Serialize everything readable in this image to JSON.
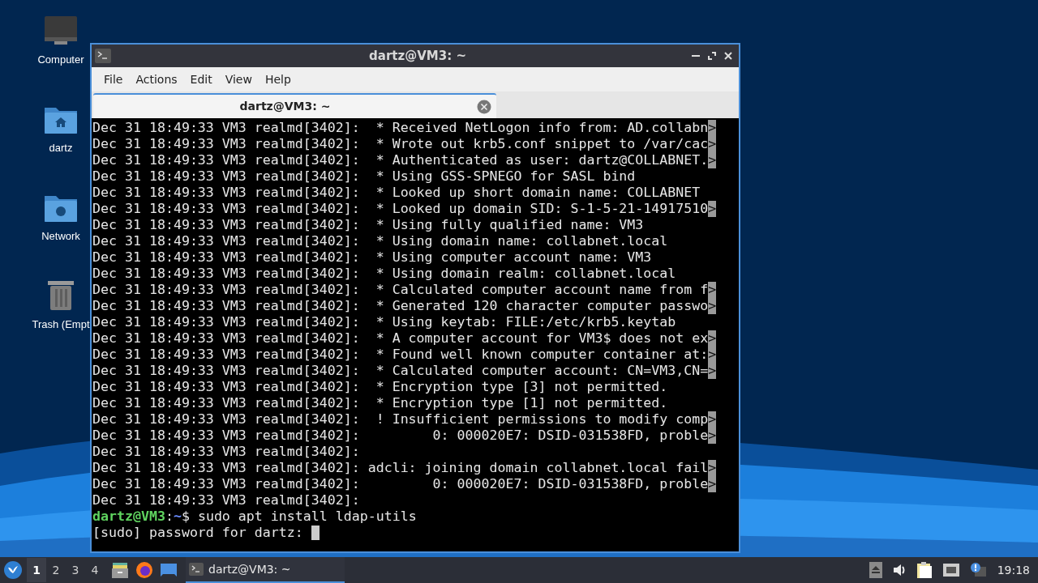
{
  "desktop_icons": [
    {
      "kind": "computer",
      "label": "Computer"
    },
    {
      "kind": "home",
      "label": "dartz"
    },
    {
      "kind": "network",
      "label": "Network"
    },
    {
      "kind": "trash",
      "label": "Trash (Empt"
    }
  ],
  "window": {
    "title": "dartz@VM3: ~",
    "menu": [
      "File",
      "Actions",
      "Edit",
      "View",
      "Help"
    ],
    "tab": {
      "label": "dartz@VM3: ~",
      "selected": true
    }
  },
  "terminal": {
    "lines": [
      {
        "text": "Dec 31 18:49:33 VM3 realmd[3402]:  * Received NetLogon info from: AD.collabn",
        "overflow": ">"
      },
      {
        "text": "Dec 31 18:49:33 VM3 realmd[3402]:  * Wrote out krb5.conf snippet to /var/cac",
        "overflow": ">"
      },
      {
        "text": "Dec 31 18:49:33 VM3 realmd[3402]:  * Authenticated as user: dartz@COLLABNET.",
        "overflow": ">"
      },
      {
        "text": "Dec 31 18:49:33 VM3 realmd[3402]:  * Using GSS-SPNEGO for SASL bind"
      },
      {
        "text": "Dec 31 18:49:33 VM3 realmd[3402]:  * Looked up short domain name: COLLABNET"
      },
      {
        "text": "Dec 31 18:49:33 VM3 realmd[3402]:  * Looked up domain SID: S-1-5-21-14917510",
        "overflow": ">"
      },
      {
        "text": "Dec 31 18:49:33 VM3 realmd[3402]:  * Using fully qualified name: VM3"
      },
      {
        "text": "Dec 31 18:49:33 VM3 realmd[3402]:  * Using domain name: collabnet.local"
      },
      {
        "text": "Dec 31 18:49:33 VM3 realmd[3402]:  * Using computer account name: VM3"
      },
      {
        "text": "Dec 31 18:49:33 VM3 realmd[3402]:  * Using domain realm: collabnet.local"
      },
      {
        "text": "Dec 31 18:49:33 VM3 realmd[3402]:  * Calculated computer account name from f",
        "overflow": ">"
      },
      {
        "text": "Dec 31 18:49:33 VM3 realmd[3402]:  * Generated 120 character computer passwo",
        "overflow": ">"
      },
      {
        "text": "Dec 31 18:49:33 VM3 realmd[3402]:  * Using keytab: FILE:/etc/krb5.keytab"
      },
      {
        "text": "Dec 31 18:49:33 VM3 realmd[3402]:  * A computer account for VM3$ does not ex",
        "overflow": ">"
      },
      {
        "text": "Dec 31 18:49:33 VM3 realmd[3402]:  * Found well known computer container at:",
        "overflow": ">"
      },
      {
        "text": "Dec 31 18:49:33 VM3 realmd[3402]:  * Calculated computer account: CN=VM3,CN=",
        "overflow": ">"
      },
      {
        "text": "Dec 31 18:49:33 VM3 realmd[3402]:  * Encryption type [3] not permitted."
      },
      {
        "text": "Dec 31 18:49:33 VM3 realmd[3402]:  * Encryption type [1] not permitted."
      },
      {
        "text": "Dec 31 18:49:33 VM3 realmd[3402]:  ! Insufficient permissions to modify comp",
        "overflow": ">"
      },
      {
        "text": "Dec 31 18:49:33 VM3 realmd[3402]:         0: 000020E7: DSID-031538FD, proble",
        "overflow": ">"
      },
      {
        "text": "Dec 31 18:49:33 VM3 realmd[3402]:"
      },
      {
        "text": "Dec 31 18:49:33 VM3 realmd[3402]: adcli: joining domain collabnet.local fail",
        "overflow": ">"
      },
      {
        "text": "Dec 31 18:49:33 VM3 realmd[3402]:         0: 000020E7: DSID-031538FD, proble",
        "overflow": ">"
      },
      {
        "text": "Dec 31 18:49:33 VM3 realmd[3402]:"
      }
    ],
    "prompt": {
      "user": "dartz@VM3",
      "sep": ":",
      "path": "~",
      "command": "$ sudo apt install ldap-utils"
    },
    "last_line": "[sudo] password for dartz: "
  },
  "taskbar": {
    "workspaces": [
      {
        "label": "1",
        "selected": true
      },
      {
        "label": "2",
        "selected": false
      },
      {
        "label": "3",
        "selected": false
      },
      {
        "label": "4",
        "selected": false
      }
    ],
    "task": {
      "label": "dartz@VM3: ~",
      "selected": true
    },
    "clock": "19:18"
  }
}
